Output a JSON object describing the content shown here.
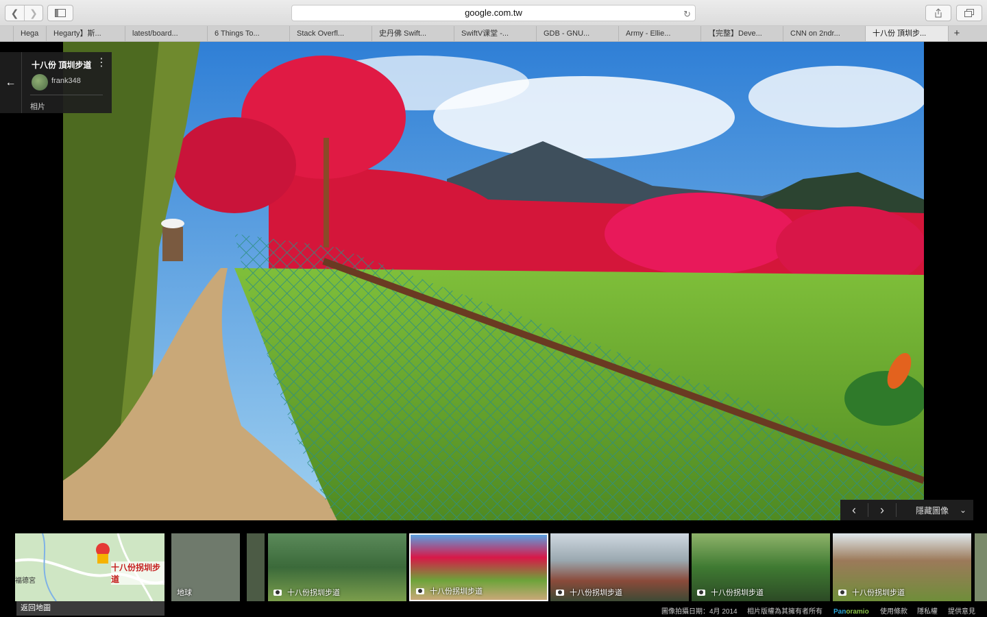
{
  "browser": {
    "url": "google.com.tw",
    "tabs": [
      {
        "label": ""
      },
      {
        "label": "Hega"
      },
      {
        "label": "Hegarty】斯..."
      },
      {
        "label": "latest/board..."
      },
      {
        "label": "6 Things To..."
      },
      {
        "label": "Stack Overfl..."
      },
      {
        "label": "史丹佛 Swift..."
      },
      {
        "label": "SwiftV课堂 -..."
      },
      {
        "label": "GDB - GNU..."
      },
      {
        "label": "Army - Ellie..."
      },
      {
        "label": "【完整】Deve..."
      },
      {
        "label": "CNN on 2ndr..."
      },
      {
        "label": "十八份 頂圳步..."
      }
    ],
    "new_tab": "+"
  },
  "info_card": {
    "title": "十八份 頂圳步道",
    "user": "frank348",
    "photos_label": "相片"
  },
  "controls": {
    "zoom_in": "+",
    "zoom_out": "−",
    "hide_images": "隱藏圖像"
  },
  "filmstrip": {
    "map_place": "十八份拐圳步道",
    "map_temple": "福德宮",
    "map_back": "返回地圖",
    "earth_label": "地球",
    "thumbs": [
      {
        "caption": "十八份拐圳步道"
      },
      {
        "caption": "十八份拐圳步道"
      },
      {
        "caption": "十八份拐圳步道"
      },
      {
        "caption": "十八份拐圳步道"
      },
      {
        "caption": "十八份拐圳步道"
      }
    ]
  },
  "footer": {
    "date": "圖像拍攝日期：4月 2014",
    "copyright": "相片版權為其擁有者所有",
    "panoramio_a": "Pan",
    "panoramio_b": "oramio",
    "terms": "使用條款",
    "privacy": "隱私權",
    "feedback": "提供意見"
  }
}
